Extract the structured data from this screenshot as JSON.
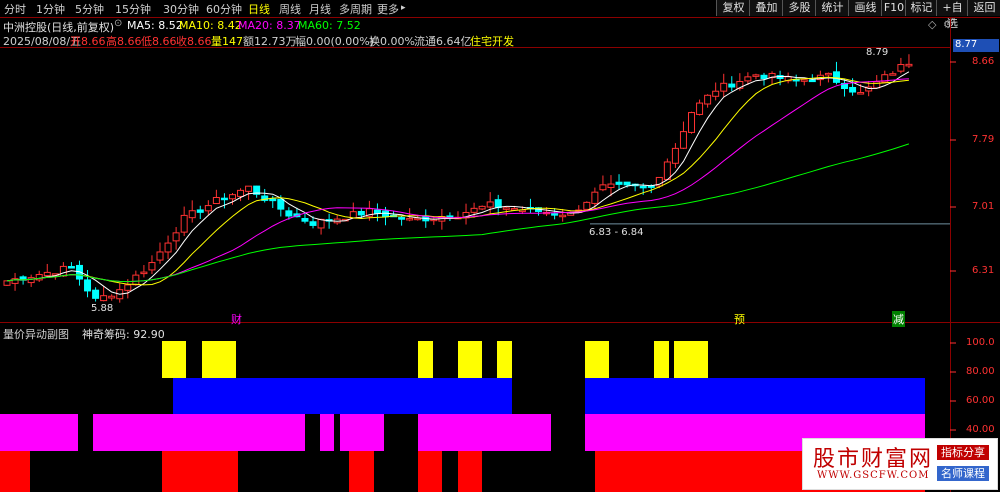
{
  "toolbar": {
    "periods": [
      "分时",
      "1分钟",
      "5分钟",
      "15分钟",
      "30分钟",
      "60分钟",
      "日线",
      "周线",
      "月线",
      "多周期",
      "更多"
    ],
    "active_period": "日线",
    "more_arrow": "▸",
    "right_buttons": [
      "复权",
      "叠加",
      "多股",
      "统计",
      "画线",
      "F10",
      "标记",
      "+自选",
      "返回"
    ]
  },
  "info": {
    "stock_title": "中洲控股(日线,前复权)",
    "ma5": "MA5: 8.52",
    "ma10": "MA10: 8.42",
    "ma20": "MA20: 8.37",
    "ma60": "MA60: 7.52",
    "date": "2025/08/08/五",
    "open": "开8.66",
    "high": "高8.66",
    "low": "低8.66",
    "close": "收8.66",
    "volume": "量147",
    "amount": "额12.73万",
    "change": "幅0.00(0.00%)",
    "turnover": "换0.00%",
    "float_cap": "流通6.64亿",
    "sector": "住宅开发"
  },
  "price_axis": {
    "labels": [
      "8.66",
      "7.79",
      "7.01",
      "6.31"
    ],
    "current_price_tag": "8.77",
    "ref_line_price": 6.84
  },
  "annotations": {
    "high_label": "8.79",
    "low_label": "5.88",
    "range_label": "6.83 - 6.84",
    "event_markers": [
      "财",
      "预",
      "减"
    ]
  },
  "indicator": {
    "title": "量价异动副图",
    "value": "神奇筹码: 92.90",
    "axis_labels": [
      "100.0",
      "80.00",
      "60.00",
      "40.00"
    ]
  },
  "colors": {
    "up": "#ff3232",
    "down": "#00ffff",
    "ma5": "#ffffff",
    "ma10": "#ffff00",
    "ma20": "#ff00ff",
    "ma60": "#00ff00",
    "yellow_band": "#ffff00",
    "blue_band": "#0000ff",
    "magenta_band": "#ff00ff",
    "red_band": "#ff0000"
  },
  "watermark": {
    "title": "股市财富网",
    "url": "WWW.GSCFW.COM",
    "badge1": "指标分享",
    "badge2": "名师课程"
  }
}
